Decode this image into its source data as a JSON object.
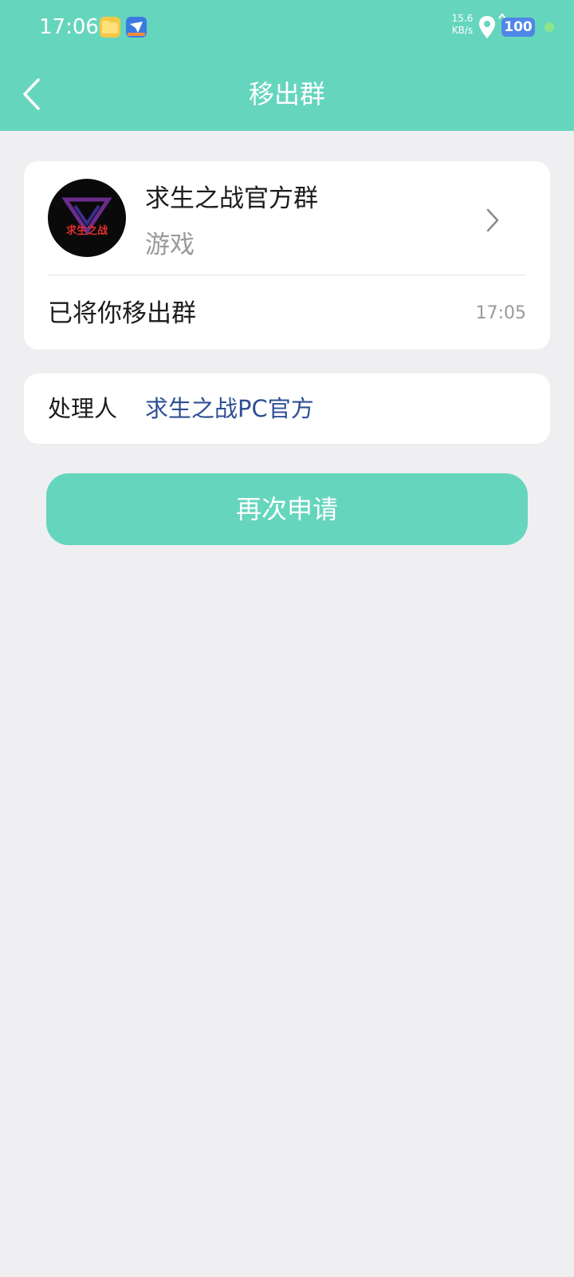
{
  "status_bar": {
    "time": "17:06",
    "net_speed_value": "15.6",
    "net_speed_unit": "KB/s",
    "battery": "100"
  },
  "header": {
    "title": "移出群",
    "back_icon": "chevron-left-icon"
  },
  "group_card": {
    "avatar_text": "求生之战",
    "name": "求生之战官方群",
    "category": "游戏",
    "notice": "已将你移出群",
    "time": "17:05"
  },
  "handler": {
    "label": "处理人",
    "name": "求生之战PC官方"
  },
  "actions": {
    "reapply_label": "再次申请"
  },
  "colors": {
    "accent": "#66D5BE",
    "background": "#EFEFF1",
    "handler_link": "#2F4F95"
  }
}
